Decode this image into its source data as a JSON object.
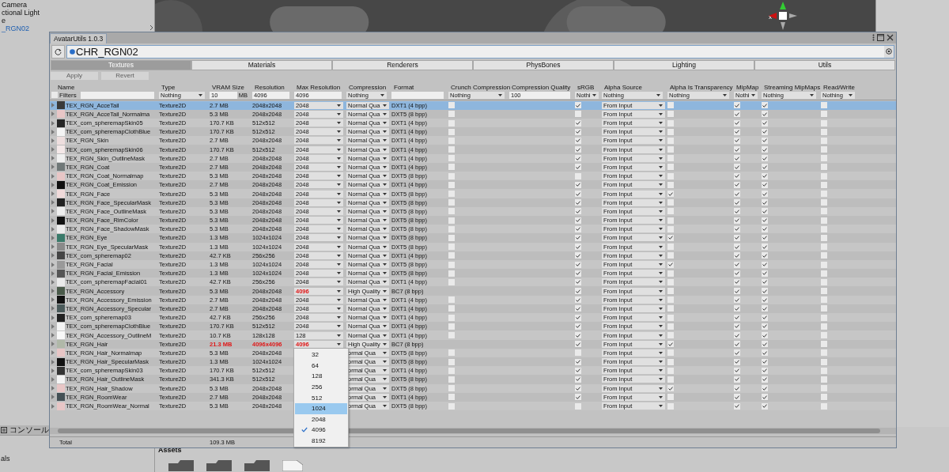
{
  "hierarchy": {
    "items": [
      {
        "label": "Camera",
        "selected": false
      },
      {
        "label": "ctional Light",
        "selected": false
      },
      {
        "label": "e",
        "selected": false
      },
      {
        "label": "_RGN02",
        "selected": true
      }
    ]
  },
  "scene": {
    "axis_label": "x"
  },
  "window": {
    "title": "AvatarUtils 1.0.3"
  },
  "object_field": {
    "value": "CHR_RGN02"
  },
  "tabs": [
    {
      "label": "Textures",
      "selected": true
    },
    {
      "label": "Materials",
      "selected": false
    },
    {
      "label": "Renderers",
      "selected": false
    },
    {
      "label": "PhysBones",
      "selected": false
    },
    {
      "label": "Lighting",
      "selected": false
    },
    {
      "label": "Utils",
      "selected": false
    }
  ],
  "buttons": [
    {
      "label": "Apply",
      "disabled": true
    },
    {
      "label": "Revert",
      "disabled": true
    }
  ],
  "table": {
    "columns": [
      "Name",
      "Type",
      "VRAM Size",
      "Resolution",
      "Max Resolution",
      "Compression",
      "Format",
      "Crunch Compression",
      "Compression Quality",
      "sRGB",
      "Alpha Source",
      "Alpha Is Transparency",
      "MipMap",
      "Streaming MipMaps",
      "Read/Write"
    ],
    "filters": [
      {
        "kind": "name",
        "label": "Filters",
        "checked": false
      },
      {
        "kind": "dropdown",
        "value": "Nothing"
      },
      {
        "kind": "field",
        "value": "10",
        "unit": "MB"
      },
      {
        "kind": "field",
        "value": "4096"
      },
      {
        "kind": "field",
        "value": "4096"
      },
      {
        "kind": "dropdown",
        "value": "Nothing"
      },
      {
        "kind": "field"
      },
      {
        "kind": "dropdown",
        "value": "Nothing"
      },
      {
        "kind": "field",
        "value": "100"
      },
      {
        "kind": "dropdown",
        "value": "Nothi"
      },
      {
        "kind": "dropdown",
        "value": "Nothing"
      },
      {
        "kind": "dropdown",
        "value": "Nothing"
      },
      {
        "kind": "dropdown",
        "value": "Nothi"
      },
      {
        "kind": "dropdown",
        "value": "Nothing"
      },
      {
        "kind": "dropdown",
        "value": "Nothing"
      }
    ],
    "rows": [
      {
        "name": "TEX_RGN_AcceTail",
        "color": "#3a3a3a",
        "type": "Texture2D",
        "vram": "2.7 MB",
        "vram_alert": false,
        "resolution": "2048x2048",
        "resolution_alert": false,
        "max_resolution": "2048",
        "max_resolution_alert": false,
        "compression": "Normal Qua",
        "format": "DXT1 (4 bpp)",
        "crunch": false,
        "srgb": true,
        "alpha_source": "From Input",
        "alpha_is_transparency": false,
        "mipmap": true,
        "streaming_mipmaps": true,
        "read_write": false,
        "selected": true
      },
      {
        "name": "TEX_RGN_AcceTail_Normalma",
        "color": "#e8c6c6",
        "type": "Texture2D",
        "vram": "5.3 MB",
        "vram_alert": false,
        "resolution": "2048x2048",
        "resolution_alert": false,
        "max_resolution": "2048",
        "max_resolution_alert": false,
        "compression": "Normal Qua",
        "format": "DXT5 (8 bpp)",
        "crunch": false,
        "srgb": false,
        "alpha_source": "From Input",
        "alpha_is_transparency": false,
        "mipmap": true,
        "streaming_mipmaps": true,
        "read_write": false,
        "selected": false
      },
      {
        "name": "TEX_com_spheremapSkin05",
        "color": "#262626",
        "type": "Texture2D",
        "vram": "170.7 KB",
        "vram_alert": false,
        "resolution": "512x512",
        "resolution_alert": false,
        "max_resolution": "2048",
        "max_resolution_alert": false,
        "compression": "Normal Qua",
        "format": "DXT1 (4 bpp)",
        "crunch": false,
        "srgb": true,
        "alpha_source": "From Input",
        "alpha_is_transparency": false,
        "mipmap": true,
        "streaming_mipmaps": true,
        "read_write": false,
        "selected": false
      },
      {
        "name": "TEX_com_spheremapClothBlue",
        "color": "#f4f4f4",
        "type": "Texture2D",
        "vram": "170.7 KB",
        "vram_alert": false,
        "resolution": "512x512",
        "resolution_alert": false,
        "max_resolution": "2048",
        "max_resolution_alert": false,
        "compression": "Normal Qua",
        "format": "DXT1 (4 bpp)",
        "crunch": false,
        "srgb": true,
        "alpha_source": "From Input",
        "alpha_is_transparency": false,
        "mipmap": true,
        "streaming_mipmaps": true,
        "read_write": false,
        "selected": false
      },
      {
        "name": "TEX_RGN_Skin",
        "color": "#eedede",
        "type": "Texture2D",
        "vram": "2.7 MB",
        "vram_alert": false,
        "resolution": "2048x2048",
        "resolution_alert": false,
        "max_resolution": "2048",
        "max_resolution_alert": false,
        "compression": "Normal Qua",
        "format": "DXT1 (4 bpp)",
        "crunch": false,
        "srgb": true,
        "alpha_source": "From Input",
        "alpha_is_transparency": false,
        "mipmap": true,
        "streaming_mipmaps": true,
        "read_write": false,
        "selected": false
      },
      {
        "name": "TEX_com_spheremapSkin06",
        "color": "#f4e8e8",
        "type": "Texture2D",
        "vram": "170.7 KB",
        "vram_alert": false,
        "resolution": "512x512",
        "resolution_alert": false,
        "max_resolution": "2048",
        "max_resolution_alert": false,
        "compression": "Normal Qua",
        "format": "DXT1 (4 bpp)",
        "crunch": false,
        "srgb": true,
        "alpha_source": "From Input",
        "alpha_is_transparency": false,
        "mipmap": true,
        "streaming_mipmaps": true,
        "read_write": false,
        "selected": false
      },
      {
        "name": "TEX_RGN_Skin_OutlineMask",
        "color": "#f0f0f0",
        "type": "Texture2D",
        "vram": "2.7 MB",
        "vram_alert": false,
        "resolution": "2048x2048",
        "resolution_alert": false,
        "max_resolution": "2048",
        "max_resolution_alert": false,
        "compression": "Normal Qua",
        "format": "DXT1 (4 bpp)",
        "crunch": false,
        "srgb": true,
        "alpha_source": "From Input",
        "alpha_is_transparency": false,
        "mipmap": true,
        "streaming_mipmaps": true,
        "read_write": false,
        "selected": false
      },
      {
        "name": "TEX_RGN_Coat",
        "color": "#707878",
        "type": "Texture2D",
        "vram": "2.7 MB",
        "vram_alert": false,
        "resolution": "2048x2048",
        "resolution_alert": false,
        "max_resolution": "2048",
        "max_resolution_alert": false,
        "compression": "Normal Qua",
        "format": "DXT1 (4 bpp)",
        "crunch": false,
        "srgb": true,
        "alpha_source": "From Input",
        "alpha_is_transparency": false,
        "mipmap": true,
        "streaming_mipmaps": true,
        "read_write": false,
        "selected": false
      },
      {
        "name": "TEX_RGN_Coat_Normalmap",
        "color": "#e8c6c6",
        "type": "Texture2D",
        "vram": "5.3 MB",
        "vram_alert": false,
        "resolution": "2048x2048",
        "resolution_alert": false,
        "max_resolution": "2048",
        "max_resolution_alert": false,
        "compression": "Normal Qua",
        "format": "DXT5 (8 bpp)",
        "crunch": false,
        "srgb": false,
        "alpha_source": "From Input",
        "alpha_is_transparency": false,
        "mipmap": true,
        "streaming_mipmaps": true,
        "read_write": false,
        "selected": false
      },
      {
        "name": "TEX_RGN_Coat_Emission",
        "color": "#101010",
        "type": "Texture2D",
        "vram": "2.7 MB",
        "vram_alert": false,
        "resolution": "2048x2048",
        "resolution_alert": false,
        "max_resolution": "2048",
        "max_resolution_alert": false,
        "compression": "Normal Qua",
        "format": "DXT1 (4 bpp)",
        "crunch": false,
        "srgb": true,
        "alpha_source": "From Input",
        "alpha_is_transparency": false,
        "mipmap": true,
        "streaming_mipmaps": true,
        "read_write": false,
        "selected": false
      },
      {
        "name": "TEX_RGN_Face",
        "color": "#f0dada",
        "type": "Texture2D",
        "vram": "5.3 MB",
        "vram_alert": false,
        "resolution": "2048x2048",
        "resolution_alert": false,
        "max_resolution": "2048",
        "max_resolution_alert": false,
        "compression": "Normal Qua",
        "format": "DXT5 (8 bpp)",
        "crunch": false,
        "srgb": true,
        "alpha_source": "From Input",
        "alpha_is_transparency": true,
        "mipmap": true,
        "streaming_mipmaps": true,
        "read_write": false,
        "selected": false
      },
      {
        "name": "TEX_RGN_Face_SpecularMask",
        "color": "#222222",
        "type": "Texture2D",
        "vram": "5.3 MB",
        "vram_alert": false,
        "resolution": "2048x2048",
        "resolution_alert": false,
        "max_resolution": "2048",
        "max_resolution_alert": false,
        "compression": "Normal Qua",
        "format": "DXT5 (8 bpp)",
        "crunch": false,
        "srgb": true,
        "alpha_source": "From Input",
        "alpha_is_transparency": false,
        "mipmap": true,
        "streaming_mipmaps": true,
        "read_write": false,
        "selected": false
      },
      {
        "name": "TEX_RGN_Face_OutlineMask",
        "color": "#eeeeee",
        "type": "Texture2D",
        "vram": "5.3 MB",
        "vram_alert": false,
        "resolution": "2048x2048",
        "resolution_alert": false,
        "max_resolution": "2048",
        "max_resolution_alert": false,
        "compression": "Normal Qua",
        "format": "DXT5 (8 bpp)",
        "crunch": false,
        "srgb": true,
        "alpha_source": "From Input",
        "alpha_is_transparency": false,
        "mipmap": true,
        "streaming_mipmaps": true,
        "read_write": false,
        "selected": false
      },
      {
        "name": "TEX_RGN_Face_RimColor",
        "color": "#111111",
        "type": "Texture2D",
        "vram": "5.3 MB",
        "vram_alert": false,
        "resolution": "2048x2048",
        "resolution_alert": false,
        "max_resolution": "2048",
        "max_resolution_alert": false,
        "compression": "Normal Qua",
        "format": "DXT5 (8 bpp)",
        "crunch": false,
        "srgb": true,
        "alpha_source": "From Input",
        "alpha_is_transparency": false,
        "mipmap": true,
        "streaming_mipmaps": true,
        "read_write": false,
        "selected": false
      },
      {
        "name": "TEX_RGN_Face_ShadowMask",
        "color": "#ececec",
        "type": "Texture2D",
        "vram": "5.3 MB",
        "vram_alert": false,
        "resolution": "2048x2048",
        "resolution_alert": false,
        "max_resolution": "2048",
        "max_resolution_alert": false,
        "compression": "Normal Qua",
        "format": "DXT5 (8 bpp)",
        "crunch": false,
        "srgb": true,
        "alpha_source": "From Input",
        "alpha_is_transparency": false,
        "mipmap": true,
        "streaming_mipmaps": true,
        "read_write": false,
        "selected": false
      },
      {
        "name": "TEX_RGN_Eye",
        "color": "#3a7a6a",
        "type": "Texture2D",
        "vram": "1.3 MB",
        "vram_alert": false,
        "resolution": "1024x1024",
        "resolution_alert": false,
        "max_resolution": "2048",
        "max_resolution_alert": false,
        "compression": "Normal Qua",
        "format": "DXT5 (8 bpp)",
        "crunch": false,
        "srgb": true,
        "alpha_source": "From Input",
        "alpha_is_transparency": true,
        "mipmap": true,
        "streaming_mipmaps": true,
        "read_write": false,
        "selected": false
      },
      {
        "name": "TEX_RGN_Eye_SpecularMask",
        "color": "#8a8a8a",
        "type": "Texture2D",
        "vram": "1.3 MB",
        "vram_alert": false,
        "resolution": "1024x1024",
        "resolution_alert": false,
        "max_resolution": "2048",
        "max_resolution_alert": false,
        "compression": "Normal Qua",
        "format": "DXT5 (8 bpp)",
        "crunch": false,
        "srgb": true,
        "alpha_source": "From Input",
        "alpha_is_transparency": false,
        "mipmap": true,
        "streaming_mipmaps": true,
        "read_write": false,
        "selected": false
      },
      {
        "name": "TEX_com_spheremap02",
        "color": "#444444",
        "type": "Texture2D",
        "vram": "42.7 KB",
        "vram_alert": false,
        "resolution": "256x256",
        "resolution_alert": false,
        "max_resolution": "2048",
        "max_resolution_alert": false,
        "compression": "Normal Qua",
        "format": "DXT1 (4 bpp)",
        "crunch": false,
        "srgb": true,
        "alpha_source": "From Input",
        "alpha_is_transparency": false,
        "mipmap": true,
        "streaming_mipmaps": true,
        "read_write": false,
        "selected": false
      },
      {
        "name": "TEX_RGN_Facial",
        "color": "#999999",
        "type": "Texture2D",
        "vram": "1.3 MB",
        "vram_alert": false,
        "resolution": "1024x1024",
        "resolution_alert": false,
        "max_resolution": "2048",
        "max_resolution_alert": false,
        "compression": "Normal Qua",
        "format": "DXT5 (8 bpp)",
        "crunch": false,
        "srgb": true,
        "alpha_source": "From Input",
        "alpha_is_transparency": true,
        "mipmap": true,
        "streaming_mipmaps": true,
        "read_write": false,
        "selected": false
      },
      {
        "name": "TEX_RGN_Facial_Emission",
        "color": "#555555",
        "type": "Texture2D",
        "vram": "1.3 MB",
        "vram_alert": false,
        "resolution": "1024x1024",
        "resolution_alert": false,
        "max_resolution": "2048",
        "max_resolution_alert": false,
        "compression": "Normal Qua",
        "format": "DXT5 (8 bpp)",
        "crunch": false,
        "srgb": true,
        "alpha_source": "From Input",
        "alpha_is_transparency": false,
        "mipmap": true,
        "streaming_mipmaps": true,
        "read_write": false,
        "selected": false
      },
      {
        "name": "TEX_com_spheremapFacial01",
        "color": "#eaeaea",
        "type": "Texture2D",
        "vram": "42.7 KB",
        "vram_alert": false,
        "resolution": "256x256",
        "resolution_alert": false,
        "max_resolution": "2048",
        "max_resolution_alert": false,
        "compression": "Normal Qua",
        "format": "DXT1 (4 bpp)",
        "crunch": false,
        "srgb": true,
        "alpha_source": "From Input",
        "alpha_is_transparency": false,
        "mipmap": true,
        "streaming_mipmaps": true,
        "read_write": false,
        "selected": false
      },
      {
        "name": "TEX_RGN_Accessory",
        "color": "#4a5a4a",
        "type": "Texture2D",
        "vram": "5.3 MB",
        "vram_alert": false,
        "resolution": "2048x2048",
        "resolution_alert": false,
        "max_resolution": "4096",
        "max_resolution_alert": true,
        "compression": "High Quality",
        "format": "BC7 (8 bpp)",
        "srgb": true,
        "alpha_source": "From Input",
        "alpha_is_transparency": false,
        "mipmap": true,
        "streaming_mipmaps": true,
        "read_write": false,
        "selected": false
      },
      {
        "name": "TEX_RGN_Accessory_Emission",
        "color": "#111111",
        "type": "Texture2D",
        "vram": "2.7 MB",
        "vram_alert": false,
        "resolution": "2048x2048",
        "resolution_alert": false,
        "max_resolution": "2048",
        "max_resolution_alert": false,
        "compression": "Normal Qua",
        "format": "DXT1 (4 bpp)",
        "crunch": false,
        "srgb": true,
        "alpha_source": "From Input",
        "alpha_is_transparency": false,
        "mipmap": true,
        "streaming_mipmaps": true,
        "read_write": false,
        "selected": false
      },
      {
        "name": "TEX_RGN_Accessory_Specular",
        "color": "#4a5a5a",
        "type": "Texture2D",
        "vram": "2.7 MB",
        "vram_alert": false,
        "resolution": "2048x2048",
        "resolution_alert": false,
        "max_resolution": "2048",
        "max_resolution_alert": false,
        "compression": "Normal Qua",
        "format": "DXT1 (4 bpp)",
        "crunch": false,
        "srgb": true,
        "alpha_source": "From Input",
        "alpha_is_transparency": false,
        "mipmap": true,
        "streaming_mipmaps": true,
        "read_write": false,
        "selected": false
      },
      {
        "name": "TEX_com_spheremap03",
        "color": "#222222",
        "type": "Texture2D",
        "vram": "42.7 KB",
        "vram_alert": false,
        "resolution": "256x256",
        "resolution_alert": false,
        "max_resolution": "2048",
        "max_resolution_alert": false,
        "compression": "Normal Qua",
        "format": "DXT1 (4 bpp)",
        "crunch": false,
        "srgb": true,
        "alpha_source": "From Input",
        "alpha_is_transparency": false,
        "mipmap": true,
        "streaming_mipmaps": true,
        "read_write": false,
        "selected": false
      },
      {
        "name": "TEX_com_spheremapClothBlue",
        "color": "#f4f4f4",
        "type": "Texture2D",
        "vram": "170.7 KB",
        "vram_alert": false,
        "resolution": "512x512",
        "resolution_alert": false,
        "max_resolution": "2048",
        "max_resolution_alert": false,
        "compression": "Normal Qua",
        "format": "DXT1 (4 bpp)",
        "crunch": false,
        "srgb": true,
        "alpha_source": "From Input",
        "alpha_is_transparency": false,
        "mipmap": true,
        "streaming_mipmaps": true,
        "read_write": false,
        "selected": false
      },
      {
        "name": "TEX_RGN_Accessory_OutlineM",
        "color": "#f8f8f8",
        "type": "Texture2D",
        "vram": "10.7 KB",
        "vram_alert": false,
        "resolution": "128x128",
        "resolution_alert": false,
        "max_resolution": "128",
        "max_resolution_alert": false,
        "compression": "Normal Qua",
        "format": "DXT1 (4 bpp)",
        "crunch": false,
        "srgb": true,
        "alpha_source": "From Input",
        "alpha_is_transparency": false,
        "mipmap": true,
        "streaming_mipmaps": true,
        "read_write": false,
        "selected": false
      },
      {
        "name": "TEX_RGN_Hair",
        "color": "#b0b8a8",
        "type": "Texture2D",
        "vram": "21.3 MB",
        "vram_alert": true,
        "resolution": "4096x4096",
        "resolution_alert": true,
        "max_resolution": "4096",
        "max_resolution_alert": true,
        "compression": "High Quality",
        "format": "BC7 (8 bpp)",
        "srgb": true,
        "alpha_source": "From Input",
        "alpha_is_transparency": true,
        "mipmap": true,
        "streaming_mipmaps": true,
        "read_write": false,
        "selected": false
      },
      {
        "name": "TEX_RGN_Hair_Normalmap",
        "color": "#e8c6c6",
        "type": "Texture2D",
        "vram": "5.3 MB",
        "vram_alert": false,
        "resolution": "2048x2048",
        "resolution_alert": false,
        "compression": "ormal Qua",
        "format": "DXT5 (8 bpp)",
        "crunch": false,
        "srgb": false,
        "alpha_source": "From Input",
        "alpha_is_transparency": false,
        "mipmap": true,
        "streaming_mipmaps": true,
        "read_write": false,
        "selected": false
      },
      {
        "name": "TEX_RGN_Hair_SpecularMask",
        "color": "#111111",
        "type": "Texture2D",
        "vram": "1.3 MB",
        "vram_alert": false,
        "resolution": "1024x1024",
        "resolution_alert": false,
        "compression": "ormal Qua",
        "format": "DXT5 (8 bpp)",
        "crunch": false,
        "srgb": true,
        "alpha_source": "From Input",
        "alpha_is_transparency": false,
        "mipmap": true,
        "streaming_mipmaps": true,
        "read_write": false,
        "selected": false
      },
      {
        "name": "TEX_com_spheremapSkin03",
        "color": "#333333",
        "type": "Texture2D",
        "vram": "170.7 KB",
        "vram_alert": false,
        "resolution": "512x512",
        "resolution_alert": false,
        "compression": "ormal Qua",
        "format": "DXT1 (4 bpp)",
        "crunch": false,
        "srgb": true,
        "alpha_source": "From Input",
        "alpha_is_transparency": false,
        "mipmap": true,
        "streaming_mipmaps": true,
        "read_write": false,
        "selected": false
      },
      {
        "name": "TEX_RGN_Hair_OutlineMask",
        "color": "#f4f4f4",
        "type": "Texture2D",
        "vram": "341.3 KB",
        "vram_alert": false,
        "resolution": "512x512",
        "resolution_alert": false,
        "compression": "ormal Qua",
        "format": "DXT5 (8 bpp)",
        "crunch": false,
        "srgb": true,
        "alpha_source": "From Input",
        "alpha_is_transparency": false,
        "mipmap": true,
        "streaming_mipmaps": true,
        "read_write": false,
        "selected": false
      },
      {
        "name": "TEX_RGN_Hair_Shadow",
        "color": "#e8c6c6",
        "type": "Texture2D",
        "vram": "5.3 MB",
        "vram_alert": false,
        "resolution": "2048x2048",
        "resolution_alert": false,
        "compression": "ormal Qua",
        "format": "DXT5 (8 bpp)",
        "crunch": false,
        "srgb": true,
        "alpha_source": "From Input",
        "alpha_is_transparency": true,
        "mipmap": true,
        "streaming_mipmaps": true,
        "read_write": false,
        "selected": false
      },
      {
        "name": "TEX_RGN_RoomWear",
        "color": "#445055",
        "type": "Texture2D",
        "vram": "2.7 MB",
        "vram_alert": false,
        "resolution": "2048x2048",
        "resolution_alert": false,
        "compression": "ormal Qua",
        "format": "DXT1 (4 bpp)",
        "crunch": false,
        "srgb": true,
        "alpha_source": "From Input",
        "alpha_is_transparency": false,
        "mipmap": true,
        "streaming_mipmaps": true,
        "read_write": false,
        "selected": false
      },
      {
        "name": "TEX_RGN_RoomWear_Normal",
        "color": "#e8c6c6",
        "type": "Texture2D",
        "vram": "5.3 MB",
        "vram_alert": false,
        "resolution": "2048x2048",
        "resolution_alert": false,
        "compression": "ormal Qua",
        "format": "DXT5 (8 bpp)",
        "crunch": false,
        "srgb": false,
        "alpha_source": "From Input",
        "alpha_is_transparency": false,
        "mipmap": true,
        "streaming_mipmaps": true,
        "read_write": false,
        "selected": false
      }
    ],
    "total": {
      "label": "Total",
      "vram": "109.3 MB"
    }
  },
  "dropdown_menu": {
    "items": [
      {
        "label": "32",
        "checked": false,
        "highlighted": false
      },
      {
        "label": "64",
        "checked": false,
        "highlighted": false
      },
      {
        "label": "128",
        "checked": false,
        "highlighted": false
      },
      {
        "label": "256",
        "checked": false,
        "highlighted": false
      },
      {
        "label": "512",
        "checked": false,
        "highlighted": false
      },
      {
        "label": "1024",
        "checked": false,
        "highlighted": true
      },
      {
        "label": "2048",
        "checked": false,
        "highlighted": false
      },
      {
        "label": "4096",
        "checked": true,
        "highlighted": false
      },
      {
        "label": "8192",
        "checked": false,
        "highlighted": false
      }
    ]
  },
  "console_tab": {
    "label": "コンソール"
  },
  "project": {
    "side_items": [
      "als"
    ],
    "header": "Assets"
  }
}
